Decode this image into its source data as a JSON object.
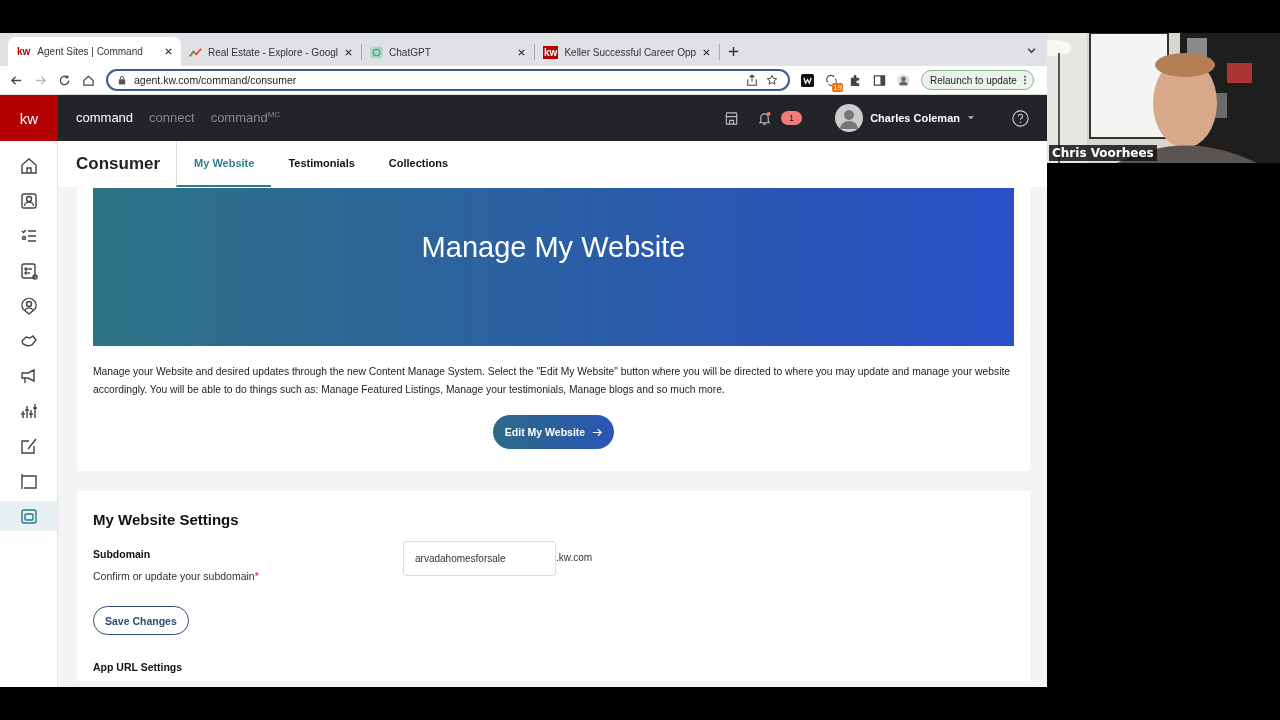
{
  "browser": {
    "tabs": [
      {
        "title": "Agent Sites | Command",
        "selected": true,
        "favicon": {
          "kind": "text",
          "text": "kw",
          "inverse": false
        }
      },
      {
        "title": "Real Estate - Explore - Googl",
        "selected": false,
        "favicon": {
          "kind": "chart"
        }
      },
      {
        "title": "ChatGPT",
        "selected": false,
        "favicon": {
          "kind": "chat"
        }
      },
      {
        "title": "Keller Successful Career Opp",
        "selected": false,
        "favicon": {
          "kind": "text",
          "text": "kw",
          "inverse": true
        }
      }
    ],
    "url": "agent.kw.com/command/consumer",
    "extension_badge": "19",
    "relaunch": "Relaunch to update"
  },
  "app": {
    "logo": "kw",
    "nav": [
      {
        "label": "command",
        "selected": true
      },
      {
        "label": "connect",
        "selected": false
      },
      {
        "label": "command",
        "selected": false,
        "sup": "MC"
      }
    ],
    "notification_count": "1",
    "user": "Charles Coleman"
  },
  "sidebar": {
    "items": [
      {
        "selected": false
      },
      {
        "selected": false
      },
      {
        "selected": false
      },
      {
        "selected": false
      },
      {
        "selected": false
      },
      {
        "selected": false
      },
      {
        "selected": false
      },
      {
        "selected": false
      },
      {
        "selected": false
      },
      {
        "selected": false
      },
      {
        "selected": true
      }
    ]
  },
  "page": {
    "title": "Consumer",
    "tabs": [
      {
        "label": "My Website",
        "selected": true
      },
      {
        "label": "Testimonials",
        "selected": false
      },
      {
        "label": "Collections",
        "selected": false
      }
    ],
    "banner": "Manage My Website",
    "intro": "Manage your Website and desired updates through the new Content Manage System. Select the \"Edit My Website\" button where you will be directed to where you may update and manage your website accordingly. You will be able to do things such as: Manage Featured Listings, Manage your testimonials, Manage blogs and so much more.",
    "edit_button": "Edit My Website",
    "settings": {
      "title": "My Website Settings",
      "label": "Subdomain",
      "hint": "Confirm or update your subdomain",
      "required_mark": "*",
      "value": "arvadahomesforsale",
      "suffix": ".kw.com",
      "save": "Save Changes"
    },
    "next_section": "App URL Settings"
  },
  "video": {
    "kind": "picture",
    "name": "Chris Voorhees"
  }
}
